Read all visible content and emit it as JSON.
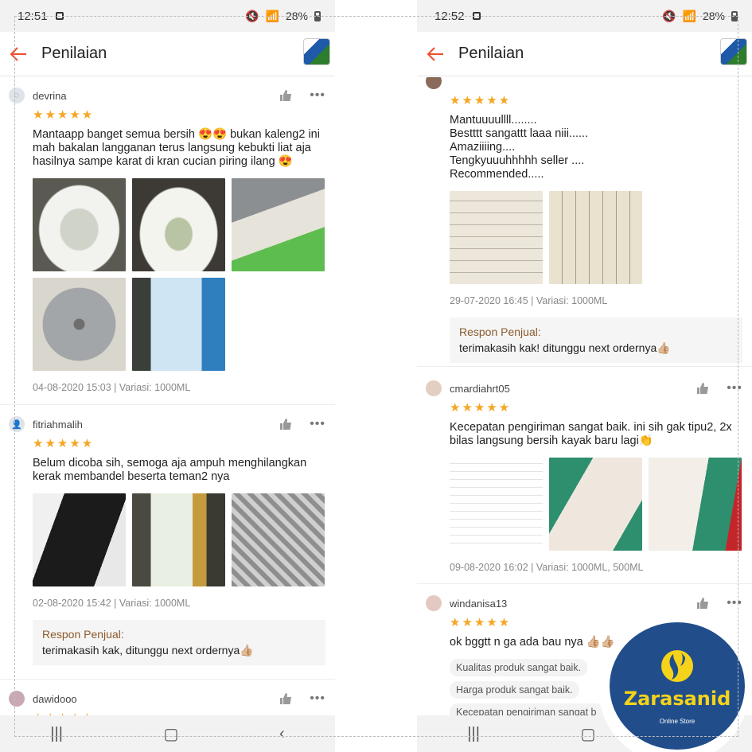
{
  "left": {
    "status": {
      "time": "12:51",
      "battery": "28%"
    },
    "header": {
      "title": "Penilaian"
    },
    "reviews": [
      {
        "user": "devrina",
        "stars": "★★★★★",
        "text": "Mantaapp banget semua bersih 😍😍 bukan kaleng2 ini mah bakalan langganan terus langsung kebukti liat aja hasilnya sampe karat di kran cucian piring ilang 😍",
        "meta": "04-08-2020 15:03 | Variasi: 1000ML"
      },
      {
        "user": "fitriahmalih",
        "stars": "★★★★★",
        "text": "Belum dicoba sih, semoga aja ampuh menghilangkan kerak membandel beserta teman2 nya",
        "meta": "02-08-2020 15:42 | Variasi: 1000ML",
        "seller_title": "Respon Penjual:",
        "seller_text": "terimakasih kak, ditunggu next ordernya👍🏼"
      },
      {
        "user": "dawidooo",
        "stars": "★★★★★"
      }
    ]
  },
  "right": {
    "status": {
      "time": "12:52",
      "battery": "28%"
    },
    "header": {
      "title": "Penilaian"
    },
    "reviews": [
      {
        "stars": "★★★★★",
        "text": "Mantuuuullll........\nBestttt sangattt laaa niii......\nAmaziiiing....\nTengkyuuuhhhhh seller ....\nRecommended.....",
        "meta": "29-07-2020 16:45 | Variasi: 1000ML",
        "seller_title": "Respon Penjual:",
        "seller_text": "terimakasih kak! ditunggu next ordernya👍🏼"
      },
      {
        "user": "cmardiahrt05",
        "stars": "★★★★★",
        "text": "Kecepatan pengiriman sangat baik. ini sih gak tipu2, 2x bilas langsung bersih kayak baru lagi👏",
        "meta": "09-08-2020 16:02 | Variasi: 1000ML, 500ML"
      },
      {
        "user": "windanisa13",
        "stars": "★★★★★",
        "text": "ok bggtt n ga ada bau nya 👍🏼👍🏼",
        "tags": [
          "Kualitas produk sangat baik.",
          "Harga produk sangat baik.",
          "Kecepatan pengiriman sangat b"
        ]
      }
    ]
  },
  "logo": {
    "name": "Zarasanid",
    "sub": "Online Store"
  },
  "colors": {
    "accent": "#ee4d2d",
    "star": "#f5a623",
    "seller_title": "#8a5a2c",
    "logo_bg": "#214e8a",
    "logo_text": "#f5d31a"
  }
}
